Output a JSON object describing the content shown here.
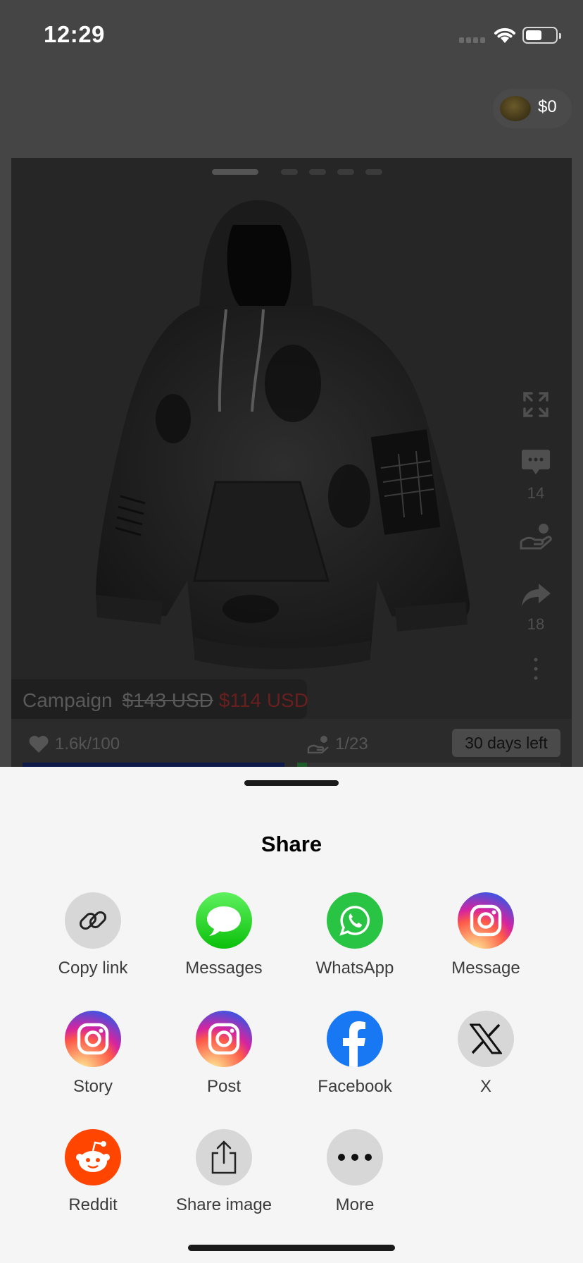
{
  "status_bar": {
    "time": "12:29"
  },
  "header": {
    "balance": "$0"
  },
  "carousel": {
    "pages": 5,
    "active_page": 1
  },
  "side_actions": {
    "expand_icon": "expand-icon",
    "comments_count": "14",
    "support_icon": "hand-heart-icon",
    "shares_count": "18",
    "more_icon": "vertical-ellipsis-icon"
  },
  "campaign": {
    "label": "Campaign",
    "original_price": "$143 USD",
    "sale_price": "$114 USD"
  },
  "stats": {
    "likes": "1.6k/100",
    "backers": "1/23",
    "days_left": "30 days left"
  },
  "share_sheet": {
    "title": "Share",
    "items": [
      {
        "label": "Copy link",
        "icon": "link-icon"
      },
      {
        "label": "Messages",
        "icon": "messages-icon"
      },
      {
        "label": "WhatsApp",
        "icon": "whatsapp-icon"
      },
      {
        "label": "Message",
        "icon": "instagram-icon"
      },
      {
        "label": "Story",
        "icon": "instagram-icon"
      },
      {
        "label": "Post",
        "icon": "instagram-icon"
      },
      {
        "label": "Facebook",
        "icon": "facebook-icon"
      },
      {
        "label": "X",
        "icon": "x-icon"
      },
      {
        "label": "Reddit",
        "icon": "reddit-icon"
      },
      {
        "label": "Share image",
        "icon": "share-upload-icon"
      },
      {
        "label": "More",
        "icon": "more-dots-icon"
      }
    ]
  },
  "colors": {
    "whatsapp": "#29c443",
    "facebook": "#1877f2",
    "reddit": "#ff4500",
    "sale_price": "#6a1f1f"
  }
}
